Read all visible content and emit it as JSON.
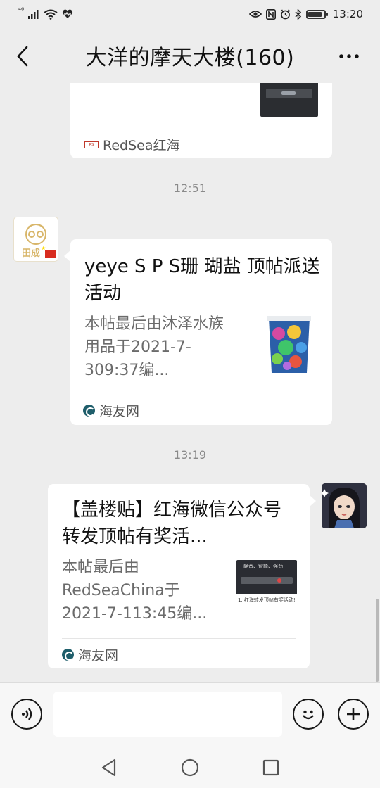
{
  "status_bar": {
    "network": "⁴⁶",
    "time": "13:20",
    "battery_level": 0.8
  },
  "header": {
    "title": "大洋的摩天大楼(160)"
  },
  "messages": [
    {
      "type": "link-card",
      "side": "left",
      "source": "RedSea红海"
    },
    {
      "type": "timestamp",
      "text": "12:51"
    },
    {
      "type": "link-card",
      "side": "left",
      "avatar_text": "田成",
      "title": "yeye S P S珊 瑚盐 顶帖派送活动",
      "desc": "本帖最后由沐泽水族用品于2021-7-309:37编...",
      "source": "海友网",
      "thumbnail": "coral-salt-bucket"
    },
    {
      "type": "timestamp",
      "text": "13:19"
    },
    {
      "type": "link-card",
      "side": "right",
      "title": "【盖楼贴】红海微信公众号转发顶帖有奖活...",
      "desc": "本帖最后由RedSeaChina于2021-7-113:45编...",
      "source": "海友网",
      "thumbnail_caption": "1. 红海转发顶帖有奖活动!",
      "thumbnail_overlay": "静音、智能、强劲"
    }
  ],
  "input_bar": {
    "placeholder": ""
  },
  "icons": {
    "back": "chevron-left-icon",
    "more": "more-dots-icon",
    "voice": "voice-icon",
    "emoji": "emoji-icon",
    "add": "plus-icon",
    "nav_back": "triangle-back-icon",
    "nav_home": "circle-home-icon",
    "nav_recent": "square-recent-icon"
  },
  "colors": {
    "background": "#ededed",
    "bubble": "#ffffff",
    "text_secondary": "#6b6b6b"
  }
}
